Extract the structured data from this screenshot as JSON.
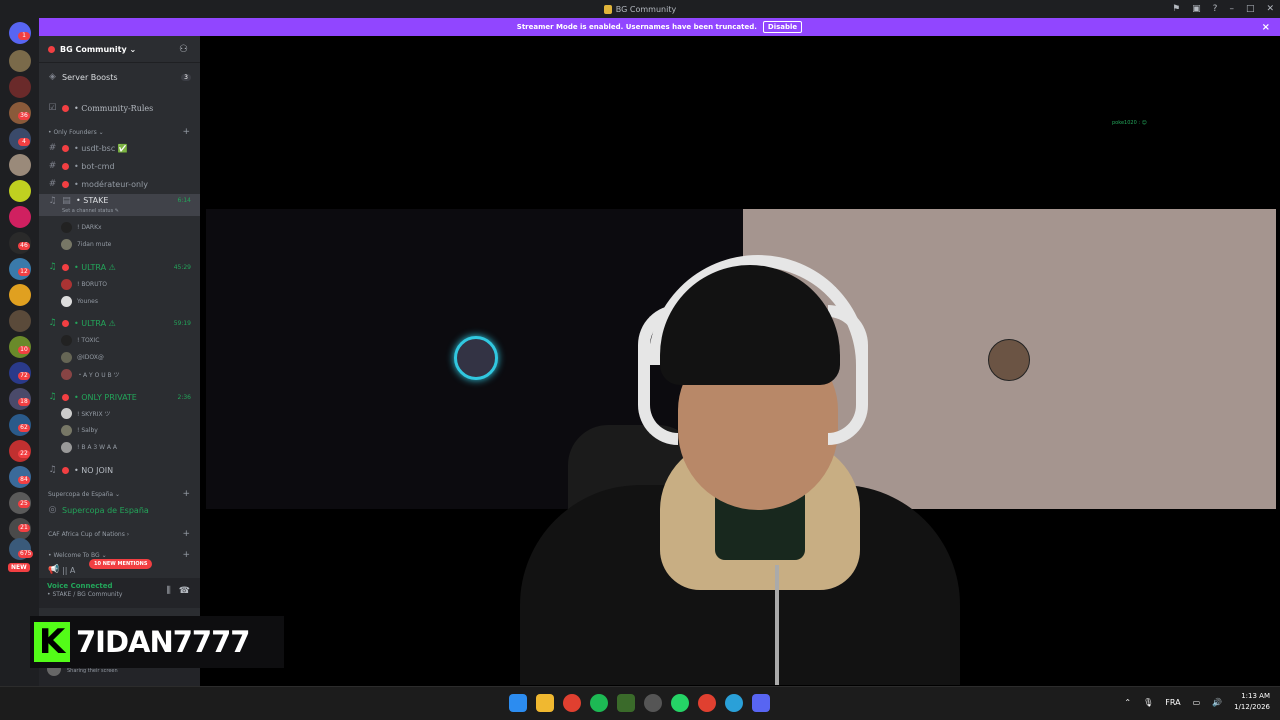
{
  "window": {
    "title": "BG Community"
  },
  "banner": {
    "text": "Streamer Mode is enabled. Usernames have been truncated.",
    "disable_label": "Disable",
    "close": "×"
  },
  "server": {
    "name": "BG Community ⌄"
  },
  "sidebar": {
    "boosts_label": "Server Boosts",
    "boosts_count": "3",
    "rules": "• Community-Rules",
    "cat_founders": "• Only Founders ⌄",
    "ch_usdt": "• usdt-bsc ✅",
    "ch_botcmd": "• bot-cmd",
    "ch_mod": "• modérateur-only",
    "vc_stake": "• STAKE",
    "vc_stake_time": "6:14",
    "vc_stake_status": "Set a channel status ✎",
    "u_darkx": "! DARKx",
    "u_7idan": "7idan mute",
    "vc_ultra1": "• ULTRA ⚠",
    "vc_ultra1_time": "45:29",
    "u_boruto": "! BORUTO",
    "u_younes": "Younes",
    "vc_ultra2": "• ULTRA ⚠",
    "vc_ultra2_time": "59:19",
    "u_toxic": "! TOXIC",
    "u_idox": "@IDOX@",
    "u_ayoub": "・A Y O U B ツ",
    "vc_private": "• ONLY PRIVATE",
    "vc_private_time": "2:36",
    "u_skyrix": "! SKYRIX ツ",
    "u_salby": "! Salby",
    "u_ba3waa": "! B A 3 W A A",
    "vc_nojoin": "• NO JOIN",
    "cat_supercopa": "Supercopa de España ⌄",
    "ch_supercopa": "Supercopa de España",
    "cat_caf": "CAF Africa Cup of Nations ›",
    "cat_welcome": "• Welcome To BG ⌄",
    "ch_annonce": "|| A",
    "mentions": "10 NEW MENTIONS"
  },
  "voice": {
    "status": "Voice Connected",
    "channel": "• STAKE / BG Community"
  },
  "userbar": {
    "status": "Sharing their screen"
  },
  "rail": {
    "new_label": "NEW",
    "badges": [
      "1",
      "",
      "",
      "36",
      "4",
      "",
      "",
      "",
      "",
      "46",
      "12",
      "",
      "",
      "10",
      "72",
      "18",
      "",
      "62",
      "22",
      "",
      "84",
      "25",
      "",
      "21",
      "675"
    ]
  },
  "stage": {
    "viewer_tag": "poke1020 : 😊"
  },
  "overlay": {
    "k": "K",
    "name": "7IDAN7777"
  },
  "taskbar": {
    "lang": "FRA",
    "time": "1:13 AM",
    "date": "1/12/2026"
  },
  "colors": {
    "streamer_banner": "#9146ff",
    "kick_green": "#53fc18",
    "voice_green": "#23a55a",
    "mention_red": "#f23f42"
  }
}
